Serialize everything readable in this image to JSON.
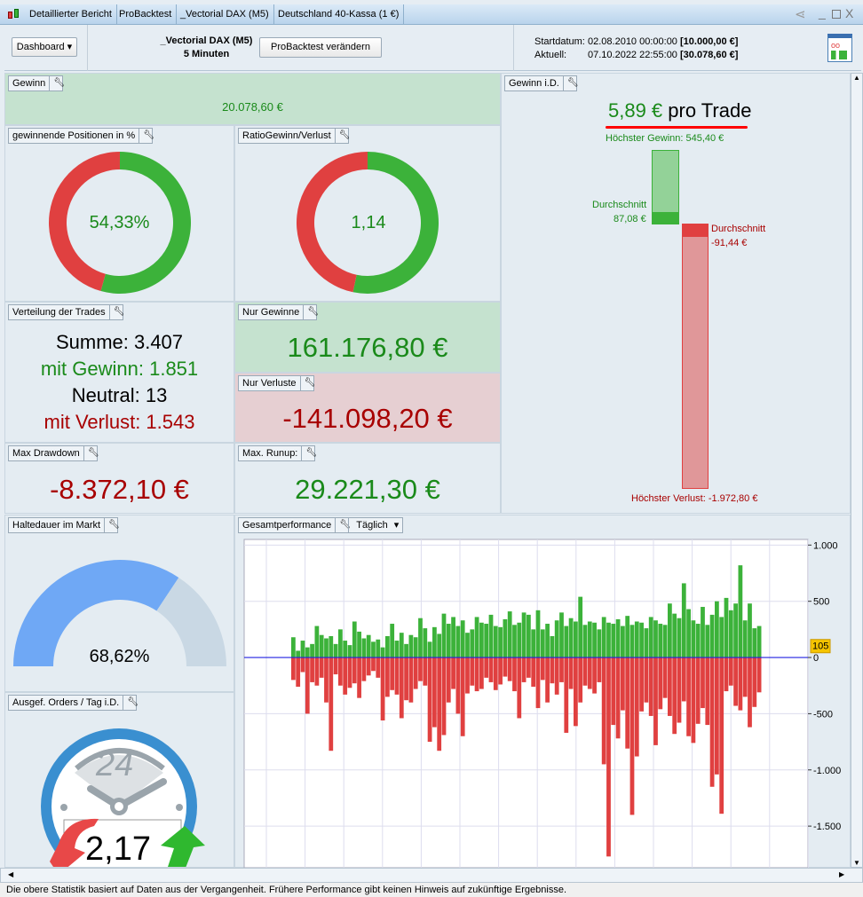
{
  "titlebar": {
    "tabs": [
      "Detaillierter Bericht",
      "ProBacktest",
      "_Vectorial DAX (M5)",
      "Deutschland 40-Kassa (1 €)"
    ]
  },
  "header": {
    "dashboard": "Dashboard",
    "system": "_Vectorial DAX (M5)",
    "timeframe": "5 Minuten",
    "change_button": "ProBacktest verändern",
    "start_label": "Startdatum:",
    "start_date": "02.08.2010 00:00:00",
    "start_capital": "[10.000,00 €]",
    "current_label": "Aktuell:",
    "current_date": "07.10.2022 22:55:00",
    "current_capital": "[30.078,60 €]"
  },
  "gewinn": {
    "title": "Gewinn",
    "value": "20.078,60 €"
  },
  "win_pct": {
    "title": "gewinnende Positionen in %",
    "value": "54,33%",
    "fraction": 0.5433
  },
  "ratio": {
    "title": "RatioGewinn/Verlust",
    "value": "1,14",
    "fraction": 0.533
  },
  "verteilung": {
    "title": "Verteilung der Trades",
    "summe": "Summe: 3.407",
    "gewinn": "mit Gewinn: 1.851",
    "neutral": "Neutral: 13",
    "verlust": "mit Verlust: 1.543"
  },
  "nur_gewinne": {
    "title": "Nur Gewinne",
    "value": "161.176,80 €"
  },
  "nur_verluste": {
    "title": "Nur Verluste",
    "value": "-141.098,20 €"
  },
  "max_drawdown": {
    "title": "Max Drawdown",
    "value": "-8.372,10 €"
  },
  "max_runup": {
    "title": "Max. Runup:",
    "value": "29.221,30 €"
  },
  "gewinn_id": {
    "title": "Gewinn i.D.",
    "per_trade_value": "5,89 €",
    "per_trade_label": "pro Trade",
    "max_gain": "Höchster Gewinn: 545,40 €",
    "avg_gain_label": "Durchschnitt",
    "avg_gain": "87,08 €",
    "avg_loss_label": "Durchschnitt",
    "avg_loss": "-91,44 €",
    "max_loss": "Höchster Verlust: -1.972,80 €"
  },
  "haltedauer": {
    "title": "Haltedauer im Markt",
    "value": "68,62%",
    "fraction": 0.6862
  },
  "orders": {
    "title": "Ausgef. Orders / Tag i.D.",
    "clock_label": "24",
    "value": "2,17"
  },
  "performance": {
    "title": "Gesamtperformance",
    "period": "Täglich"
  },
  "status": "Die obere Statistik basiert auf Daten aus der Vergangenheit. Frühere Performance gibt keinen Hinweis auf zukünftige Ergebnisse.",
  "colors": {
    "green": "#3cb23a",
    "red": "#e04040",
    "gain_text": "#1a8a1a",
    "loss_text": "#a80000",
    "zero_line": "#2020e0"
  },
  "chart_data": {
    "type": "bar",
    "ylim": [
      -1870,
      1050
    ],
    "yticks": [
      1000,
      500,
      0,
      -500,
      -1000,
      -1500
    ],
    "ytick_labels": [
      "1.000",
      "500",
      "0",
      "-500",
      "-1.000",
      "-1.500"
    ],
    "grid": true,
    "current_value_label": "105",
    "gains": [
      180,
      60,
      150,
      90,
      120,
      280,
      200,
      170,
      190,
      120,
      250,
      150,
      110,
      320,
      230,
      170,
      200,
      140,
      160,
      90,
      190,
      300,
      150,
      220,
      120,
      200,
      180,
      350,
      260,
      140,
      270,
      210,
      390,
      300,
      360,
      280,
      330,
      220,
      250,
      360,
      310,
      300,
      380,
      280,
      270,
      340,
      410,
      290,
      310,
      400,
      380,
      250,
      420,
      250,
      300,
      190,
      330,
      400,
      280,
      350,
      320,
      540,
      290,
      320,
      310,
      250,
      360,
      310,
      300,
      340,
      280,
      370,
      290,
      320,
      310,
      260,
      360,
      330,
      300,
      290,
      480,
      390,
      350,
      660,
      430,
      330,
      300,
      450,
      290,
      380,
      500,
      360,
      530,
      420,
      480,
      820,
      330,
      480,
      260,
      280
    ],
    "losses": [
      -200,
      -260,
      -130,
      -500,
      -220,
      -250,
      -180,
      -400,
      -830,
      -150,
      -250,
      -330,
      -270,
      -230,
      -360,
      -210,
      -160,
      -120,
      -180,
      -560,
      -350,
      -290,
      -330,
      -540,
      -380,
      -400,
      -280,
      -210,
      -250,
      -750,
      -620,
      -830,
      -690,
      -400,
      -280,
      -500,
      -700,
      -320,
      -250,
      -300,
      -280,
      -180,
      -220,
      -290,
      -240,
      -170,
      -210,
      -300,
      -540,
      -220,
      -180,
      -260,
      -450,
      -200,
      -400,
      -230,
      -330,
      -220,
      -670,
      -280,
      -610,
      -400,
      -250,
      -280,
      -320,
      -220,
      -950,
      -1770,
      -600,
      -720,
      -470,
      -810,
      -1400,
      -880,
      -480,
      -400,
      -520,
      -780,
      -460,
      -360,
      -520,
      -680,
      -580,
      -390,
      -700,
      -760,
      -590,
      -450,
      -600,
      -1150,
      -1040,
      -1390,
      -300,
      -250,
      -430,
      -470,
      -350,
      -620,
      -440,
      -310
    ]
  }
}
